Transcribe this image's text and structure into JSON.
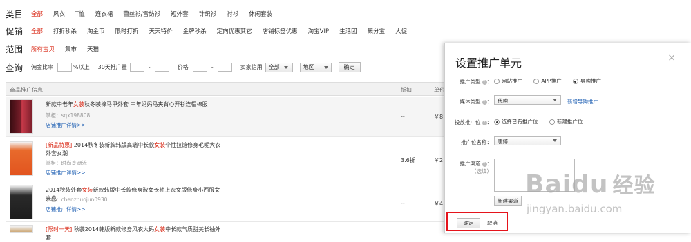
{
  "filters": {
    "category": {
      "label": "类目",
      "options": [
        "全部",
        "风衣",
        "T恤",
        "连衣裙",
        "蕾丝衫/雪纺衫",
        "短外套",
        "针织衫",
        "衬衫",
        "休闲套装"
      ],
      "active_index": 0
    },
    "promotion": {
      "label": "促销",
      "options": [
        "全部",
        "打折秒杀",
        "淘金币",
        "限时打折",
        "天天特价",
        "金牌秒杀",
        "定向优惠其它",
        "店铺标签优惠",
        "淘宝VIP",
        "生活团",
        "聚分宝",
        "大促"
      ],
      "active_index": 0
    },
    "scope": {
      "label": "范围",
      "options": [
        "所有宝贝",
        "集市",
        "天猫"
      ],
      "active_index": 0
    },
    "query": {
      "label": "查询",
      "commission_label": "佣金比率",
      "commission_suffix": "%以上",
      "sales_label": "30天推广量",
      "range_sep": "-",
      "price_label": "价格",
      "credit_label": "卖家信用",
      "credit_value": "全部",
      "region_value": "地区",
      "confirm_label": "确定"
    }
  },
  "table": {
    "headers": [
      "商品推广信息",
      "折扣",
      "单价"
    ],
    "rows": [
      {
        "title_parts": [
          "新款中老年",
          "女装",
          "秋冬装棉马甲外套 中年妈妈马夹背心开衫连帽棉服"
        ],
        "shop": "掌柜：sqx198808",
        "link": "店铺推广详情>>",
        "discount": "--",
        "price": "￥8"
      },
      {
        "tag": "[新品特惠]",
        "title_parts": [
          " 2014秋冬装新款韩版高端中长款",
          "女装",
          "个性拉链修身毛呢大衣外套女潮"
        ],
        "shop": "掌柜：时尚乡潮流",
        "link": "店铺推广详情>>",
        "discount": "3.6折",
        "price": "￥2"
      },
      {
        "title_parts": [
          "2014秋装外套",
          "女装",
          "新款韩版中长款修身淑女长袖上衣女版修身小西服女夹克"
        ],
        "shop": "掌柜：chenzhuojun0930",
        "link": "店铺推广详情>>",
        "discount": "--",
        "price": "￥4"
      },
      {
        "tag": "[限时一天]",
        "title_parts": [
          " 秋装2014韩版新款修身风衣大码",
          "女装",
          "中长款气质甜美长袖外套"
        ]
      }
    ]
  },
  "modal": {
    "title": "设置推广单元",
    "close": "×",
    "fields": {
      "promo_type": {
        "label": "推广类型",
        "options": [
          "网站推广",
          "APP推广",
          "导购推广"
        ],
        "selected_index": 2
      },
      "media_type": {
        "label": "媒体类型",
        "value": "代购",
        "link": "新增导购推广"
      },
      "slot": {
        "label": "投放推广位",
        "options": [
          "选择已有推广位",
          "新建推广位"
        ],
        "selected_index": 0
      },
      "slot_name": {
        "label": "推广位名称",
        "value": "唐婷"
      },
      "channel": {
        "label": "推广渠道",
        "hint": "（选填）",
        "new_button": "新建渠道"
      }
    },
    "confirm_label": "确定",
    "cancel_label": "取消"
  },
  "watermark": {
    "brand": "Baidu",
    "brand_cn": "经验",
    "url": "jingyan.baidu.com"
  },
  "colors": {
    "accent_red": "#d8200c",
    "link_blue": "#1e5fb3",
    "highlight_box": "#e5141c"
  }
}
